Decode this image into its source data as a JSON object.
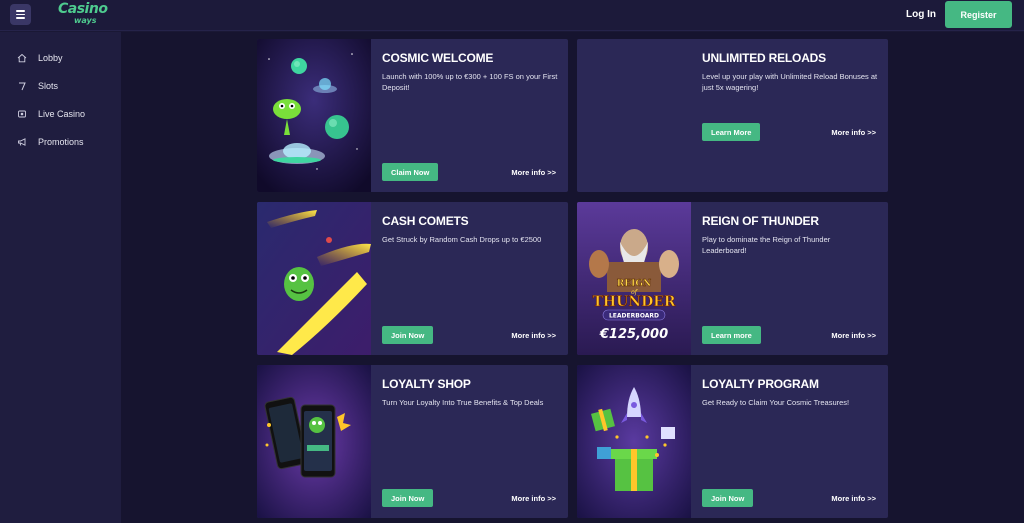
{
  "header": {
    "logo_main": "Casino",
    "logo_sub": "ways",
    "login_label": "Log In",
    "register_label": "Register"
  },
  "sidebar": {
    "items": [
      {
        "label": "Lobby",
        "icon": "home-icon"
      },
      {
        "label": "Slots",
        "icon": "slot-machine-icon"
      },
      {
        "label": "Live Casino",
        "icon": "live-casino-icon"
      },
      {
        "label": "Promotions",
        "icon": "megaphone-icon"
      }
    ]
  },
  "promotions": [
    {
      "title": "COSMIC WELCOME",
      "description": "Launch with 100% up to €300 + 100 FS on your First Deposit!",
      "button": "Claim Now",
      "more": "More info >>",
      "image": "aliens-ufo-planets"
    },
    {
      "title": "UNLIMITED RELOADS",
      "description": "Level up your play with Unlimited Reload Bonuses at just 5x wagering!",
      "button": "Learn More",
      "more": "More info >>",
      "image": ""
    },
    {
      "title": "CASH COMETS",
      "description": "Get Struck by Random Cash Drops up to €2500",
      "button": "Join Now",
      "more": "More info >>",
      "image": "alien-riding-comet"
    },
    {
      "title": "REIGN OF THUNDER",
      "description": "Play to dominate the Reign of Thunder Leaderboard!",
      "button": "Learn more",
      "more": "More info >>",
      "image": "reign-of-thunder-leaderboard",
      "image_text": {
        "line1": "REIGN",
        "line2": "of",
        "line3": "THUNDER",
        "line4": "LEADERBOARD",
        "amount": "€125,000"
      }
    },
    {
      "title": "LOYALTY SHOP",
      "description": "Turn Your Loyalty Into True Benefits & Top Deals",
      "button": "Join Now",
      "more": "More info >>",
      "image": "phones-with-alien"
    },
    {
      "title": "LOYALTY PROGRAM",
      "description": "Get Ready to Claim Your Cosmic Treasures!",
      "button": "Join Now",
      "more": "More info >>",
      "image": "rocket-gift-boxes"
    }
  ],
  "colors": {
    "accent": "#45b883",
    "card_bg": "#2b2856",
    "page_bg": "#16142f",
    "sidebar_bg": "#1f1d3f"
  }
}
